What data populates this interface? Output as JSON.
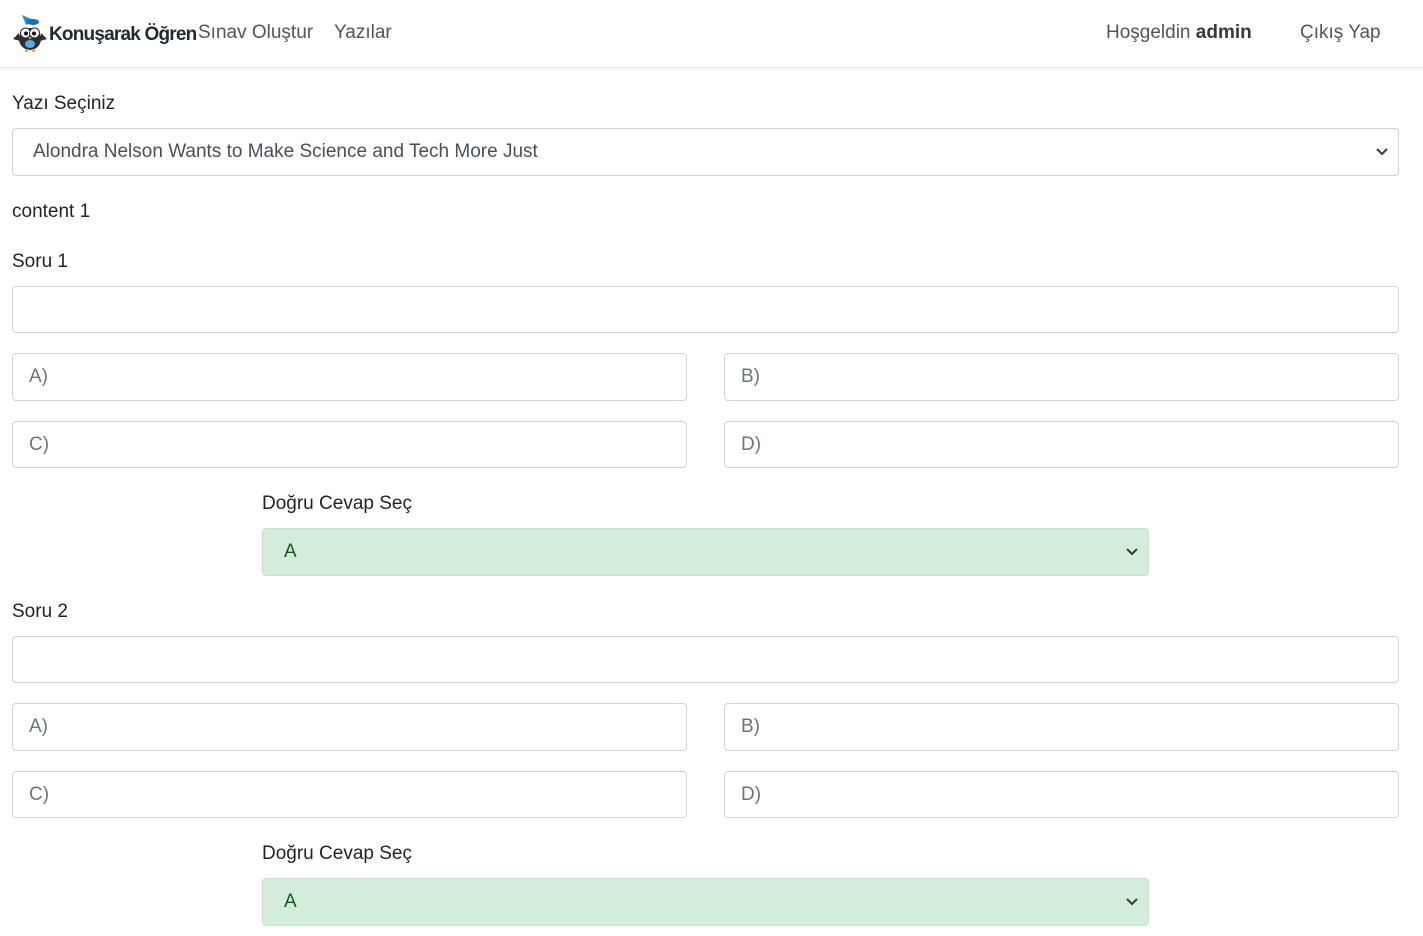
{
  "nav": {
    "brand": "Konuşarak Öğren",
    "links": [
      "Sınav Oluştur",
      "Yazılar"
    ],
    "greeting": "Hoşgeldin",
    "username": "admin",
    "logout": "Çıkış Yap"
  },
  "article_select": {
    "label": "Yazı Seçiniz",
    "value": "Alondra Nelson Wants to Make Science and Tech More Just"
  },
  "content_text": "content 1",
  "questions": [
    {
      "label": "Soru 1",
      "question_value": "",
      "options": {
        "a": "A)",
        "b": "B)",
        "c": "C)",
        "d": "D)"
      },
      "answer_label": "Doğru Cevap Seç",
      "answer_value": "A"
    },
    {
      "label": "Soru 2",
      "question_value": "",
      "options": {
        "a": "A)",
        "b": "B)",
        "c": "C)",
        "d": "D)"
      },
      "answer_label": "Doğru Cevap Seç",
      "answer_value": "A"
    }
  ],
  "icons": [
    "owl-logo-icon",
    "chevron-down-icon"
  ],
  "colors": {
    "answer_select_bg": "#d4edda",
    "answer_select_text": "#155724",
    "border": "#ced4da"
  }
}
